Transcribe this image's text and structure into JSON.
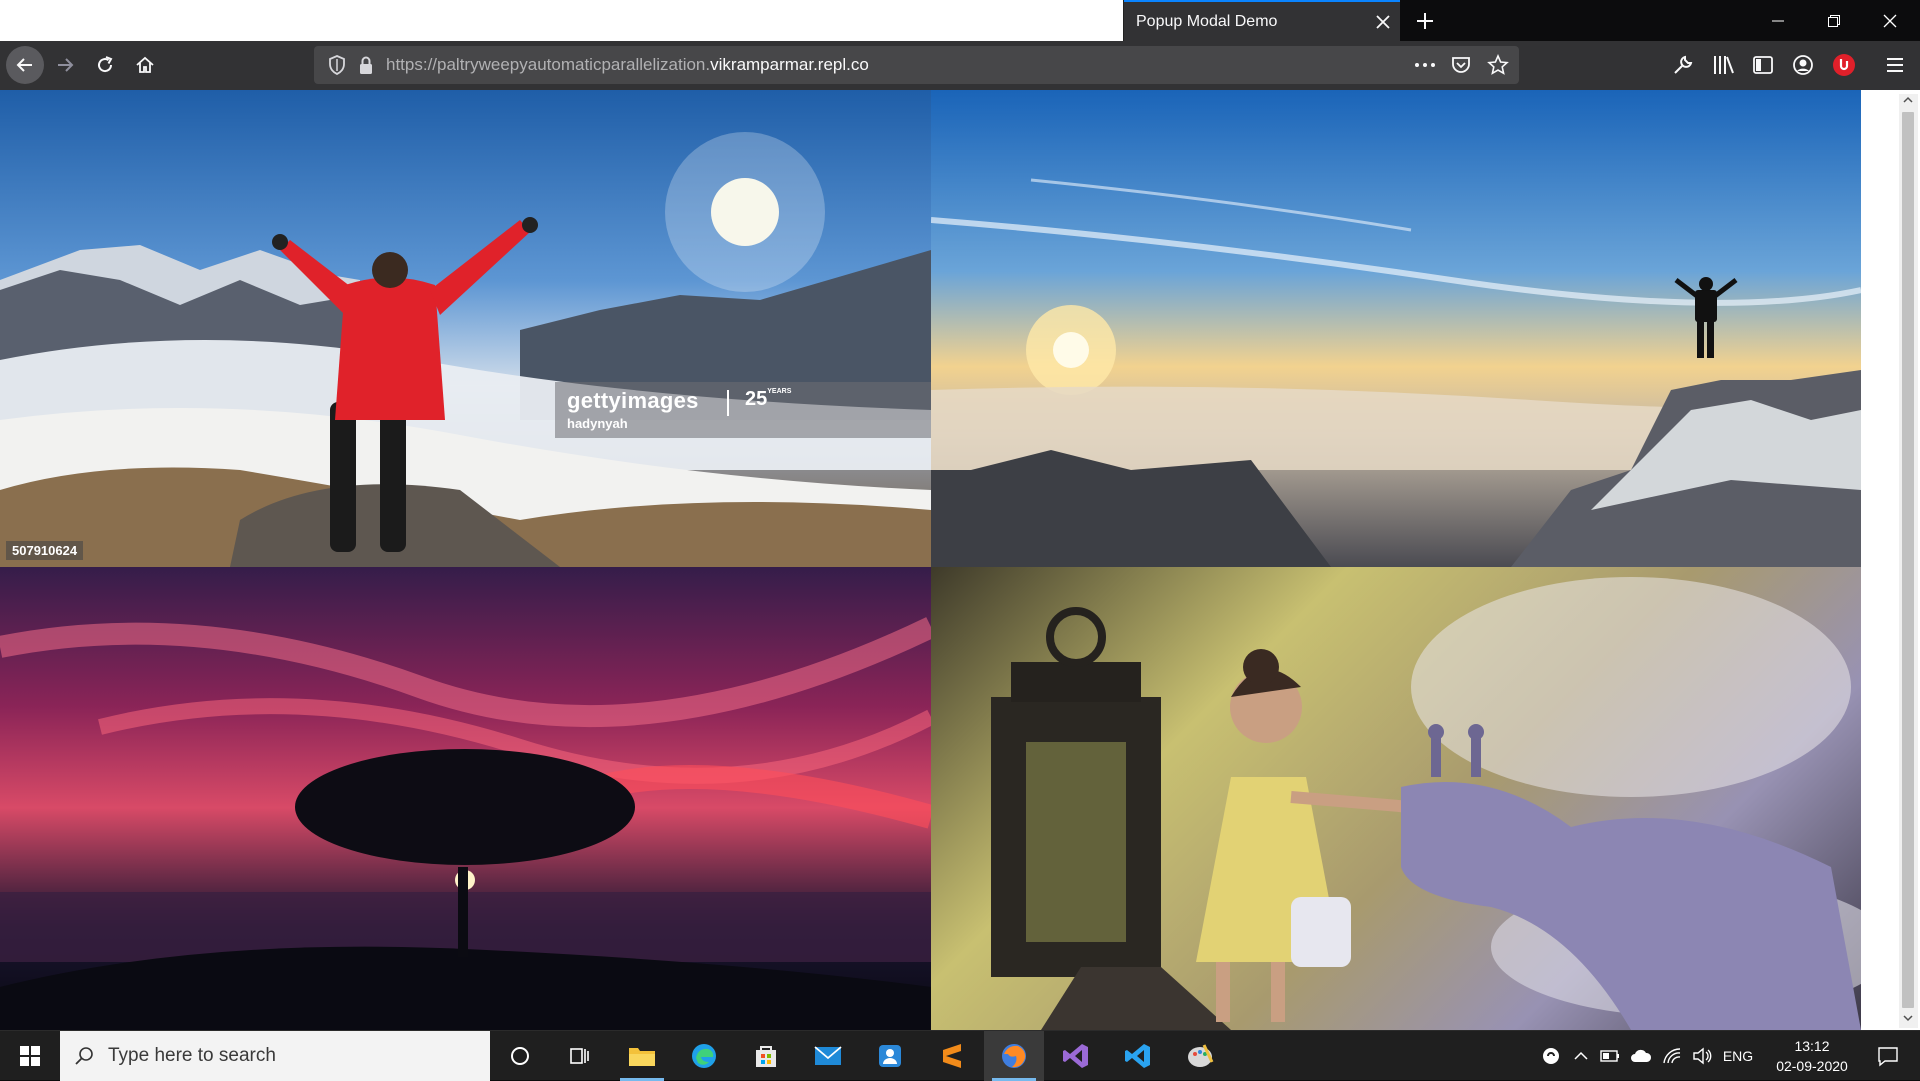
{
  "browser": {
    "tab_title": "Popup Modal Demo",
    "url_prefix": "https://paltryweepyautomaticparallelization.",
    "url_domain": "vikramparmar.repl.co",
    "icons": {
      "back": "arrow-left-icon",
      "forward": "arrow-right-icon",
      "reload": "reload-icon",
      "home": "home-icon",
      "tracking": "shield-icon",
      "lock": "lock-icon",
      "page_actions": "more-horizontal-icon",
      "pocket": "pocket-icon",
      "bookmark": "star-icon",
      "dev_tools": "wrench-icon",
      "library": "library-icon",
      "sidebar": "sidebar-icon",
      "account": "account-icon",
      "extension": "red-extension-icon",
      "menu": "hamburger-menu-icon"
    }
  },
  "photos": [
    {
      "name": "mountain-climber-red-jacket",
      "watermark": {
        "brand": "gettyimages",
        "author": "hadynyah",
        "years": "25",
        "years_suffix": "YEARS"
      },
      "stock_id": "507910624"
    },
    {
      "name": "silhouette-above-clouds"
    },
    {
      "name": "tree-sunset-red-sky"
    },
    {
      "name": "girl-with-giraffe-lantern"
    }
  ],
  "taskbar": {
    "search_placeholder": "Type here to search",
    "apps": [
      "cortana",
      "task-view",
      "file-explorer",
      "edge",
      "store",
      "mail",
      "onedrive",
      "sublime-text",
      "firefox",
      "visual-studio",
      "vscode",
      "paint"
    ],
    "tray": {
      "language": "ENG",
      "time": "13:12",
      "date": "02-09-2020"
    }
  },
  "colors": {
    "accent_tab": "#0a84ff",
    "toolbar": "#323234",
    "taskbar": "#1f1f1f"
  }
}
